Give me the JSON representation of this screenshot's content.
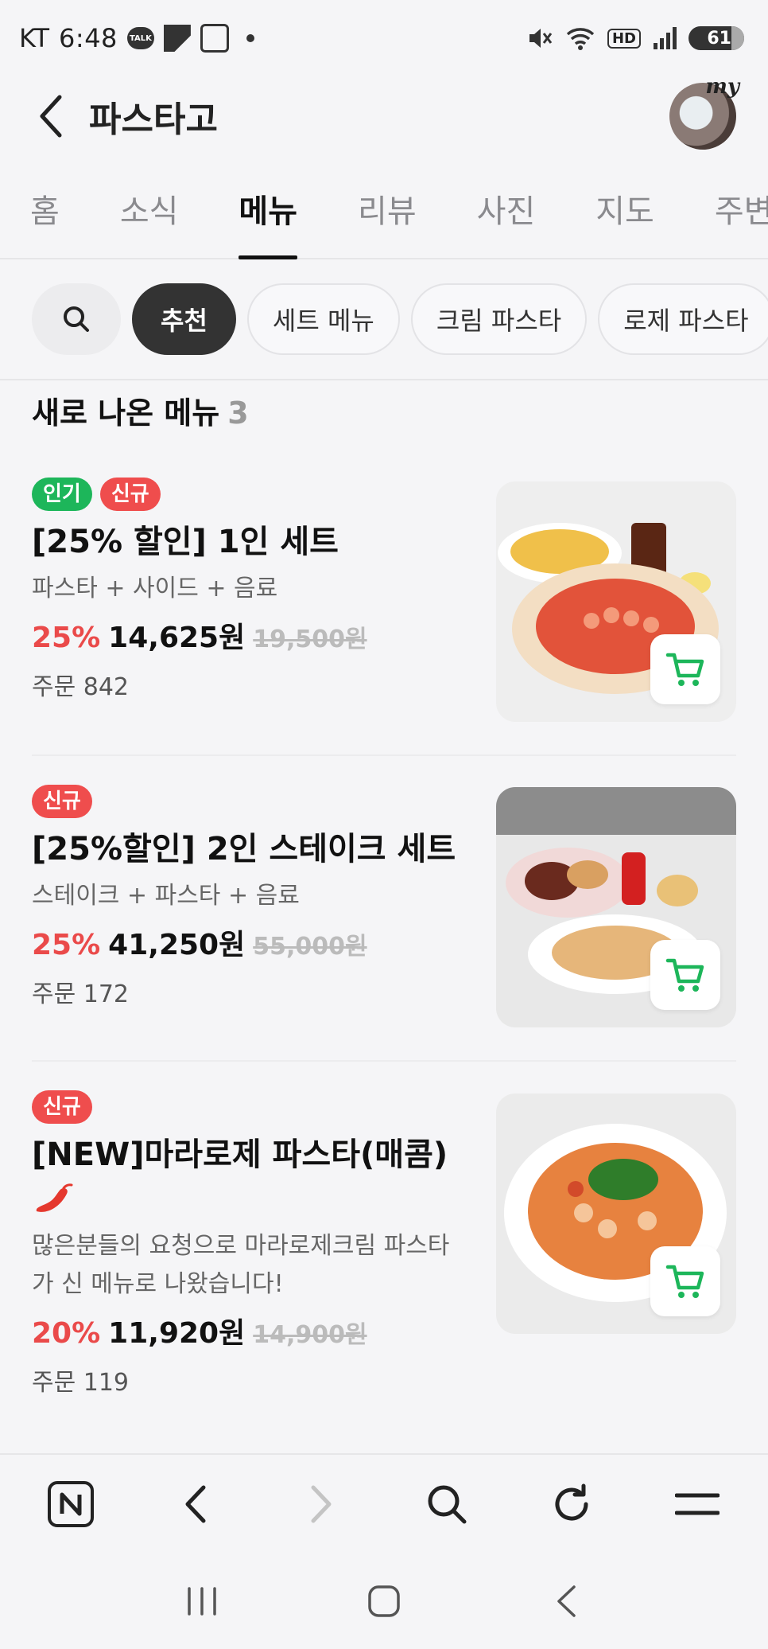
{
  "status_bar": {
    "carrier": "KT",
    "time": "6:48",
    "talk_label": "TALK",
    "battery": "61",
    "hd_label": "HD"
  },
  "header": {
    "title": "파스타고",
    "avatar_label": "my"
  },
  "tabs": [
    {
      "label": "홈"
    },
    {
      "label": "소식"
    },
    {
      "label": "메뉴",
      "active": true
    },
    {
      "label": "리뷰"
    },
    {
      "label": "사진"
    },
    {
      "label": "지도"
    },
    {
      "label": "주변"
    }
  ],
  "chips": [
    {
      "label": "추천",
      "active": true
    },
    {
      "label": "세트 메뉴"
    },
    {
      "label": "크림 파스타"
    },
    {
      "label": "로제 파스타"
    }
  ],
  "section": {
    "title": "새로 나온 메뉴",
    "count": "3"
  },
  "items": [
    {
      "badges": [
        "인기",
        "신규"
      ],
      "name": "[25% 할인] 1인 세트",
      "desc": "파스타 + 사이드 + 음료",
      "discount": "25%",
      "price": "14,625원",
      "original_price": "19,500원",
      "orders": "주문 842"
    },
    {
      "badges": [
        "신규"
      ],
      "name": "[25%할인] 2인 스테이크 세트",
      "desc": "스테이크 + 파스타 + 음료",
      "discount": "25%",
      "price": "41,250원",
      "original_price": "55,000원",
      "orders": "주문 172"
    },
    {
      "badges": [
        "신규"
      ],
      "name": "[NEW]마라로제 파스타(매콤)",
      "desc": "많은분들의 요청으로 마라로제크림 파스타가 신 메뉴로 나왔습니다!",
      "discount": "20%",
      "price": "11,920원",
      "original_price": "14,900원",
      "orders": "주문 119"
    }
  ],
  "colors": {
    "accent_red": "#ea4a4a",
    "badge_green": "#1db65a",
    "cart_green": "#1db65a"
  }
}
